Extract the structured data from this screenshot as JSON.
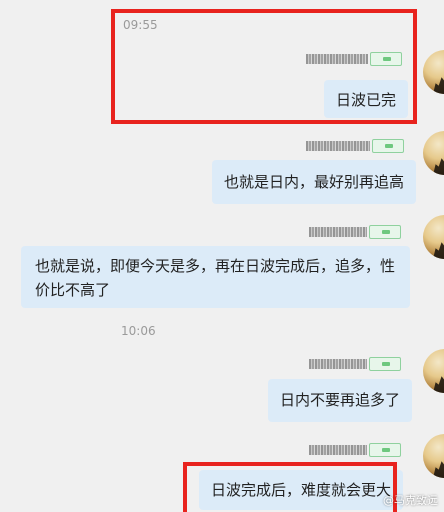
{
  "timestamps": {
    "t1": "09:55",
    "t2": "10:06"
  },
  "messages": {
    "m1": "日波已完",
    "m2": "也就是日内，最好别再追高",
    "m3": "也就是说，即便今天是多，再在日波完成后，追多，性价比不高了",
    "m4": "日内不要再追多了",
    "m5": "日波完成后，难度就会更大"
  },
  "watermark": "@马克致远",
  "colors": {
    "background": "#f0f0f0",
    "bubble": "#dcebf8",
    "highlight": "#e8231e",
    "timestamp": "#9a9a9a"
  }
}
